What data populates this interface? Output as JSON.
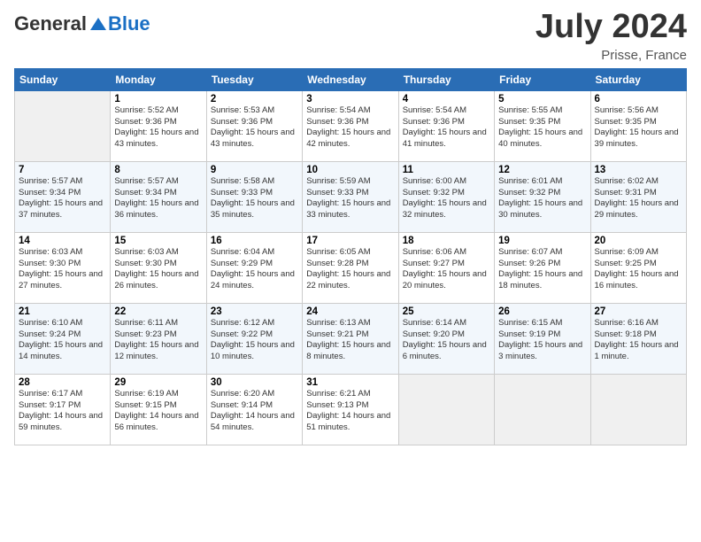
{
  "header": {
    "logo_general": "General",
    "logo_blue": "Blue",
    "title": "July 2024",
    "subtitle": "Prisse, France"
  },
  "columns": [
    "Sunday",
    "Monday",
    "Tuesday",
    "Wednesday",
    "Thursday",
    "Friday",
    "Saturday"
  ],
  "weeks": [
    [
      {
        "empty": true
      },
      {
        "day": "1",
        "sunrise": "5:52 AM",
        "sunset": "9:36 PM",
        "daylight": "15 hours and 43 minutes."
      },
      {
        "day": "2",
        "sunrise": "5:53 AM",
        "sunset": "9:36 PM",
        "daylight": "15 hours and 43 minutes."
      },
      {
        "day": "3",
        "sunrise": "5:54 AM",
        "sunset": "9:36 PM",
        "daylight": "15 hours and 42 minutes."
      },
      {
        "day": "4",
        "sunrise": "5:54 AM",
        "sunset": "9:36 PM",
        "daylight": "15 hours and 41 minutes."
      },
      {
        "day": "5",
        "sunrise": "5:55 AM",
        "sunset": "9:35 PM",
        "daylight": "15 hours and 40 minutes."
      },
      {
        "day": "6",
        "sunrise": "5:56 AM",
        "sunset": "9:35 PM",
        "daylight": "15 hours and 39 minutes."
      }
    ],
    [
      {
        "day": "7",
        "sunrise": "5:57 AM",
        "sunset": "9:34 PM",
        "daylight": "15 hours and 37 minutes."
      },
      {
        "day": "8",
        "sunrise": "5:57 AM",
        "sunset": "9:34 PM",
        "daylight": "15 hours and 36 minutes."
      },
      {
        "day": "9",
        "sunrise": "5:58 AM",
        "sunset": "9:33 PM",
        "daylight": "15 hours and 35 minutes."
      },
      {
        "day": "10",
        "sunrise": "5:59 AM",
        "sunset": "9:33 PM",
        "daylight": "15 hours and 33 minutes."
      },
      {
        "day": "11",
        "sunrise": "6:00 AM",
        "sunset": "9:32 PM",
        "daylight": "15 hours and 32 minutes."
      },
      {
        "day": "12",
        "sunrise": "6:01 AM",
        "sunset": "9:32 PM",
        "daylight": "15 hours and 30 minutes."
      },
      {
        "day": "13",
        "sunrise": "6:02 AM",
        "sunset": "9:31 PM",
        "daylight": "15 hours and 29 minutes."
      }
    ],
    [
      {
        "day": "14",
        "sunrise": "6:03 AM",
        "sunset": "9:30 PM",
        "daylight": "15 hours and 27 minutes."
      },
      {
        "day": "15",
        "sunrise": "6:03 AM",
        "sunset": "9:30 PM",
        "daylight": "15 hours and 26 minutes."
      },
      {
        "day": "16",
        "sunrise": "6:04 AM",
        "sunset": "9:29 PM",
        "daylight": "15 hours and 24 minutes."
      },
      {
        "day": "17",
        "sunrise": "6:05 AM",
        "sunset": "9:28 PM",
        "daylight": "15 hours and 22 minutes."
      },
      {
        "day": "18",
        "sunrise": "6:06 AM",
        "sunset": "9:27 PM",
        "daylight": "15 hours and 20 minutes."
      },
      {
        "day": "19",
        "sunrise": "6:07 AM",
        "sunset": "9:26 PM",
        "daylight": "15 hours and 18 minutes."
      },
      {
        "day": "20",
        "sunrise": "6:09 AM",
        "sunset": "9:25 PM",
        "daylight": "15 hours and 16 minutes."
      }
    ],
    [
      {
        "day": "21",
        "sunrise": "6:10 AM",
        "sunset": "9:24 PM",
        "daylight": "15 hours and 14 minutes."
      },
      {
        "day": "22",
        "sunrise": "6:11 AM",
        "sunset": "9:23 PM",
        "daylight": "15 hours and 12 minutes."
      },
      {
        "day": "23",
        "sunrise": "6:12 AM",
        "sunset": "9:22 PM",
        "daylight": "15 hours and 10 minutes."
      },
      {
        "day": "24",
        "sunrise": "6:13 AM",
        "sunset": "9:21 PM",
        "daylight": "15 hours and 8 minutes."
      },
      {
        "day": "25",
        "sunrise": "6:14 AM",
        "sunset": "9:20 PM",
        "daylight": "15 hours and 6 minutes."
      },
      {
        "day": "26",
        "sunrise": "6:15 AM",
        "sunset": "9:19 PM",
        "daylight": "15 hours and 3 minutes."
      },
      {
        "day": "27",
        "sunrise": "6:16 AM",
        "sunset": "9:18 PM",
        "daylight": "15 hours and 1 minute."
      }
    ],
    [
      {
        "day": "28",
        "sunrise": "6:17 AM",
        "sunset": "9:17 PM",
        "daylight": "14 hours and 59 minutes."
      },
      {
        "day": "29",
        "sunrise": "6:19 AM",
        "sunset": "9:15 PM",
        "daylight": "14 hours and 56 minutes."
      },
      {
        "day": "30",
        "sunrise": "6:20 AM",
        "sunset": "9:14 PM",
        "daylight": "14 hours and 54 minutes."
      },
      {
        "day": "31",
        "sunrise": "6:21 AM",
        "sunset": "9:13 PM",
        "daylight": "14 hours and 51 minutes."
      },
      {
        "empty": true
      },
      {
        "empty": true
      },
      {
        "empty": true
      }
    ]
  ]
}
